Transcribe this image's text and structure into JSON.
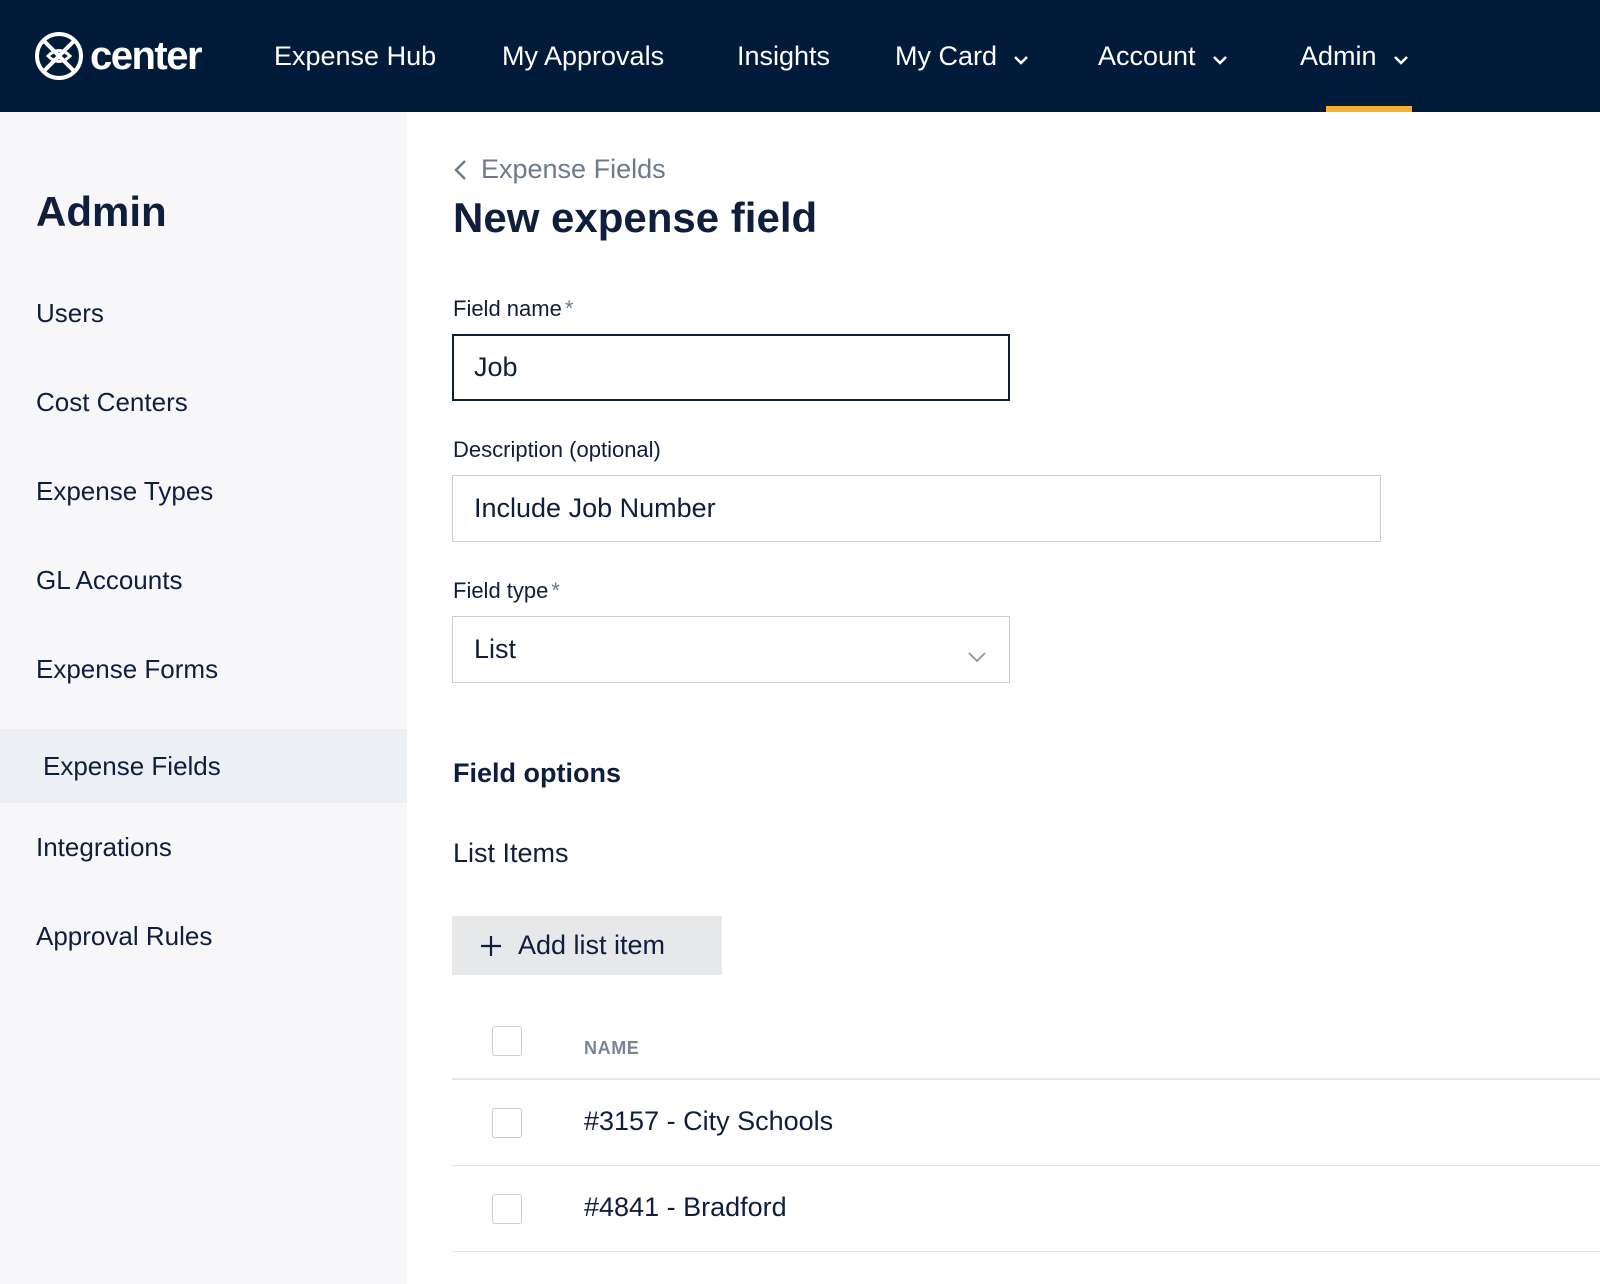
{
  "app": {
    "logo_text": "center"
  },
  "topnav": {
    "items": [
      {
        "label": "Expense Hub",
        "dropdown": false
      },
      {
        "label": "My Approvals",
        "dropdown": false
      },
      {
        "label": "Insights",
        "dropdown": false
      },
      {
        "label": "My Card",
        "dropdown": true
      },
      {
        "label": "Account",
        "dropdown": true
      },
      {
        "label": "Admin",
        "dropdown": true,
        "active": true
      }
    ],
    "accent_color": "#f3b032",
    "background_color": "#021b3b"
  },
  "sidebar": {
    "title": "Admin",
    "items": [
      {
        "label": "Users"
      },
      {
        "label": "Cost Centers"
      },
      {
        "label": "Expense Types"
      },
      {
        "label": "GL Accounts"
      },
      {
        "label": "Expense Forms"
      },
      {
        "label": "Expense Fields",
        "active": true
      },
      {
        "label": "Integrations"
      },
      {
        "label": "Approval Rules"
      }
    ]
  },
  "main": {
    "breadcrumb": "Expense Fields",
    "title": "New expense field",
    "field_name": {
      "label": "Field name",
      "required_mark": "*",
      "value": "Job"
    },
    "description": {
      "label": "Description (optional)",
      "value": "Include Job Number"
    },
    "field_type": {
      "label": "Field type",
      "required_mark": "*",
      "value": "List"
    },
    "field_options_title": "Field options",
    "list_items_title": "List Items",
    "add_button": "Add list item",
    "table": {
      "column_name": "NAME",
      "rows": [
        {
          "name": "#3157 - City Schools",
          "checked": false
        },
        {
          "name": "#4841 - Bradford",
          "checked": false
        }
      ]
    }
  }
}
